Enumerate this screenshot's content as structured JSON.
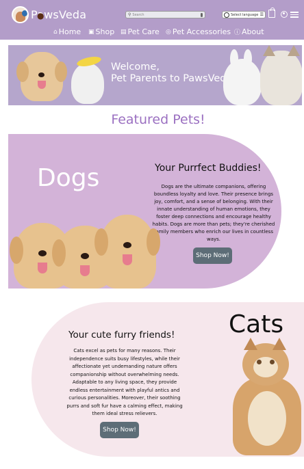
{
  "header": {
    "brand": "PawsVeda",
    "search_placeholder": "Search",
    "language_label": "Select language",
    "nav": [
      {
        "label": "Home"
      },
      {
        "label": "Shop"
      },
      {
        "label": "Pet Care"
      },
      {
        "label": "Pet Accessories"
      },
      {
        "label": "About"
      }
    ]
  },
  "hero": {
    "line1": "Welcome,",
    "line2": "Pet Parents to PawsVeda!"
  },
  "featured": {
    "heading": "Featured Pets!"
  },
  "dogs": {
    "title": "Dogs",
    "subtitle": "Your Purrfect Buddies!",
    "description": "Dogs are the ultimate companions, offering boundless loyalty and love. Their presence brings joy, comfort, and a sense of belonging. With their innate understanding of human emotions, they foster deep connections and encourage healthy habits. Dogs are more than pets; they're cherished family members who enrich our lives in countless ways.",
    "button": "Shop Now!"
  },
  "cats": {
    "title": "Cats",
    "subtitle": "Your cute furry friends!",
    "description": "Cats excel as pets for many reasons. Their independence suits busy lifestyles, while their affectionate yet undemanding nature offers companionship without overwhelming needs. Adaptable to any living space, they provide endless entertainment with playful antics and curious personalities. Moreover, their soothing purrs and soft fur have a calming effect, making them ideal stress relievers.",
    "button": "Shop Now!"
  },
  "colors": {
    "header_bg": "#b39dc9",
    "dogs_bg": "#d3b3d8",
    "cats_bg": "#f6e7ec",
    "accent": "#9b70c1",
    "button_bg": "#5d6d77"
  }
}
